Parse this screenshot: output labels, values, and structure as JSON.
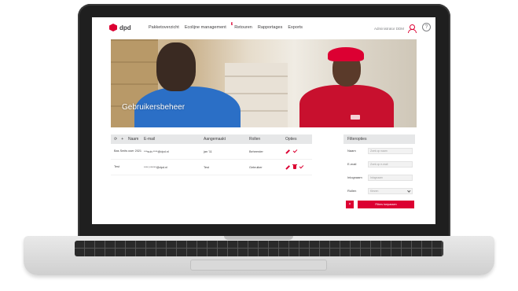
{
  "header": {
    "logo_text": "dpd",
    "nav": [
      {
        "label": "Pakketoverzicht"
      },
      {
        "label": "Ecolijne management",
        "badge": "3"
      },
      {
        "label": "Retouren"
      },
      {
        "label": "Rapportages"
      },
      {
        "label": "Exports"
      }
    ],
    "user_label": "Administrator DDM",
    "help_glyph": "?"
  },
  "hero": {
    "title": "Gebruikersbeheer"
  },
  "table": {
    "headers": {
      "icon_a": "⟳",
      "icon_b": "+",
      "name": "Naam",
      "email": "E-mail",
      "created": "Aangemaakt",
      "role": "Rollen",
      "options": "Opties"
    },
    "rows": [
      {
        "name": "Bas Smits user 2021",
        "email": "***sub.****@dpd.nl",
        "created": "jan '11",
        "role": "Beheerder"
      },
      {
        "name": "Test",
        "email": "****.******@dpd.nl",
        "created": "Test",
        "role": "Gebruiker"
      }
    ]
  },
  "filter": {
    "title": "Filteropties",
    "fields": [
      {
        "label": "Naam",
        "placeholder": "Zoek op naam"
      },
      {
        "label": "E-mail",
        "placeholder": "Zoek op e-mail"
      },
      {
        "label": "Inlognaam",
        "placeholder": "Inlognaam"
      },
      {
        "label": "Rollen",
        "placeholder": "Kiezen"
      }
    ],
    "reset_label": "×",
    "apply_label": "Filters toepassen"
  },
  "colors": {
    "brand": "#dc0032",
    "header_gray": "#e6e7e8",
    "text": "#414042"
  }
}
